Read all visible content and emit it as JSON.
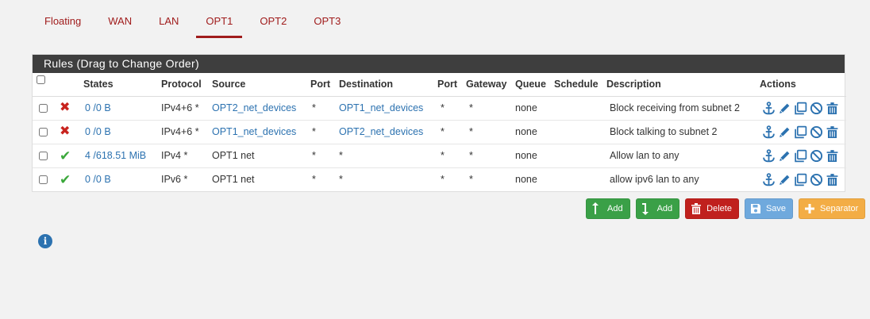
{
  "tabs": [
    "Floating",
    "WAN",
    "LAN",
    "OPT1",
    "OPT2",
    "OPT3"
  ],
  "active_tab": "OPT1",
  "panel": {
    "title": "Rules (Drag to Change Order)"
  },
  "columns": [
    "",
    "",
    "States",
    "Protocol",
    "Source",
    "Port",
    "Destination",
    "Port",
    "Gateway",
    "Queue",
    "Schedule",
    "Description",
    "Actions"
  ],
  "rules": [
    {
      "status": "block",
      "states": "0 /0 B",
      "protocol": "IPv4+6 *",
      "source": "OPT2_net_devices",
      "source_link": true,
      "sport": "*",
      "destination": "OPT1_net_devices",
      "dest_link": true,
      "dport": "*",
      "gateway": "*",
      "queue": "none",
      "schedule": "",
      "description": "Block receiving from subnet 2"
    },
    {
      "status": "block",
      "states": "0 /0 B",
      "protocol": "IPv4+6 *",
      "source": "OPT1_net_devices",
      "source_link": true,
      "sport": "*",
      "destination": "OPT2_net_devices",
      "dest_link": true,
      "dport": "*",
      "gateway": "*",
      "queue": "none",
      "schedule": "",
      "description": "Block talking to subnet 2"
    },
    {
      "status": "pass",
      "states": "4 /618.51 MiB",
      "protocol": "IPv4 *",
      "source": "OPT1 net",
      "source_link": false,
      "sport": "*",
      "destination": "*",
      "dest_link": false,
      "dport": "*",
      "gateway": "*",
      "queue": "none",
      "schedule": "",
      "description": "Allow lan to any"
    },
    {
      "status": "pass",
      "states": "0 /0 B",
      "protocol": "IPv6 *",
      "source": "OPT1 net",
      "source_link": false,
      "sport": "*",
      "destination": "*",
      "dest_link": false,
      "dport": "*",
      "gateway": "*",
      "queue": "none",
      "schedule": "",
      "description": "allow ipv6 lan to any"
    }
  ],
  "buttons": {
    "add_top": "Add",
    "add_bottom": "Add",
    "delete": "Delete",
    "save": "Save",
    "separator": "Separator"
  },
  "icons": {
    "block": "x-icon",
    "pass": "check-icon",
    "actions": [
      "anchor-icon",
      "pencil-icon",
      "copy-icon",
      "ban-icon",
      "trash-icon"
    ]
  },
  "colors": {
    "tab_accent": "#a01c1c",
    "link": "#2c72b0",
    "block": "#c8231e",
    "pass": "#3ba83b",
    "panel_header": "#3e3e3e"
  }
}
